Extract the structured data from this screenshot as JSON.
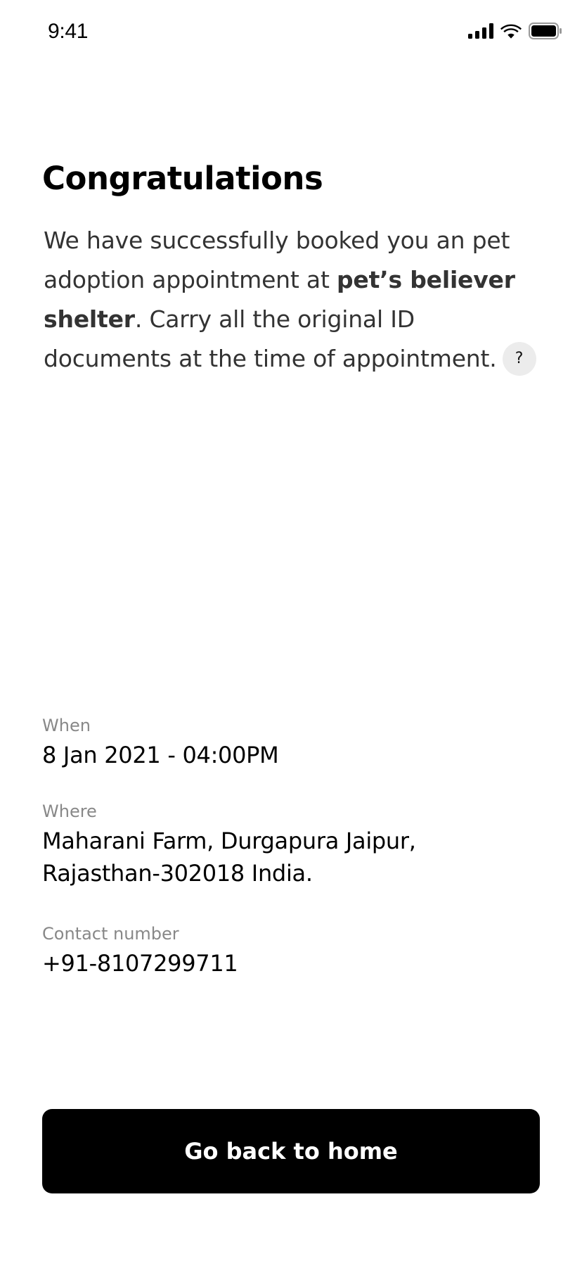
{
  "status_bar": {
    "time": "9:41",
    "icons": [
      "cellular-signal-icon",
      "wifi-icon",
      "battery-icon"
    ]
  },
  "confirmation": {
    "title": "Congratulations",
    "message_before": "We have successfully booked you an pet adoption appointment at ",
    "shelter_name": "pet’s believer shelter",
    "message_after": ". Carry all the original ID documents at the time of appointment.",
    "help_symbol": "?"
  },
  "details": {
    "when_label": "When",
    "when_value": "8 Jan 2021 - 04:00PM",
    "where_label": "Where",
    "where_line1": "Maharani Farm, Durgapura Jaipur,",
    "where_line2": "Rajasthan-302018 India.",
    "contact_label": "Contact number",
    "contact_value": "+91-8107299711"
  },
  "actions": {
    "home_label": "Go back to home"
  },
  "colors": {
    "background": "#ffffff",
    "button": "#000000",
    "button_text": "#ffffff",
    "body_text": "#333333",
    "label_text": "#888888",
    "help_badge": "#ececec"
  }
}
